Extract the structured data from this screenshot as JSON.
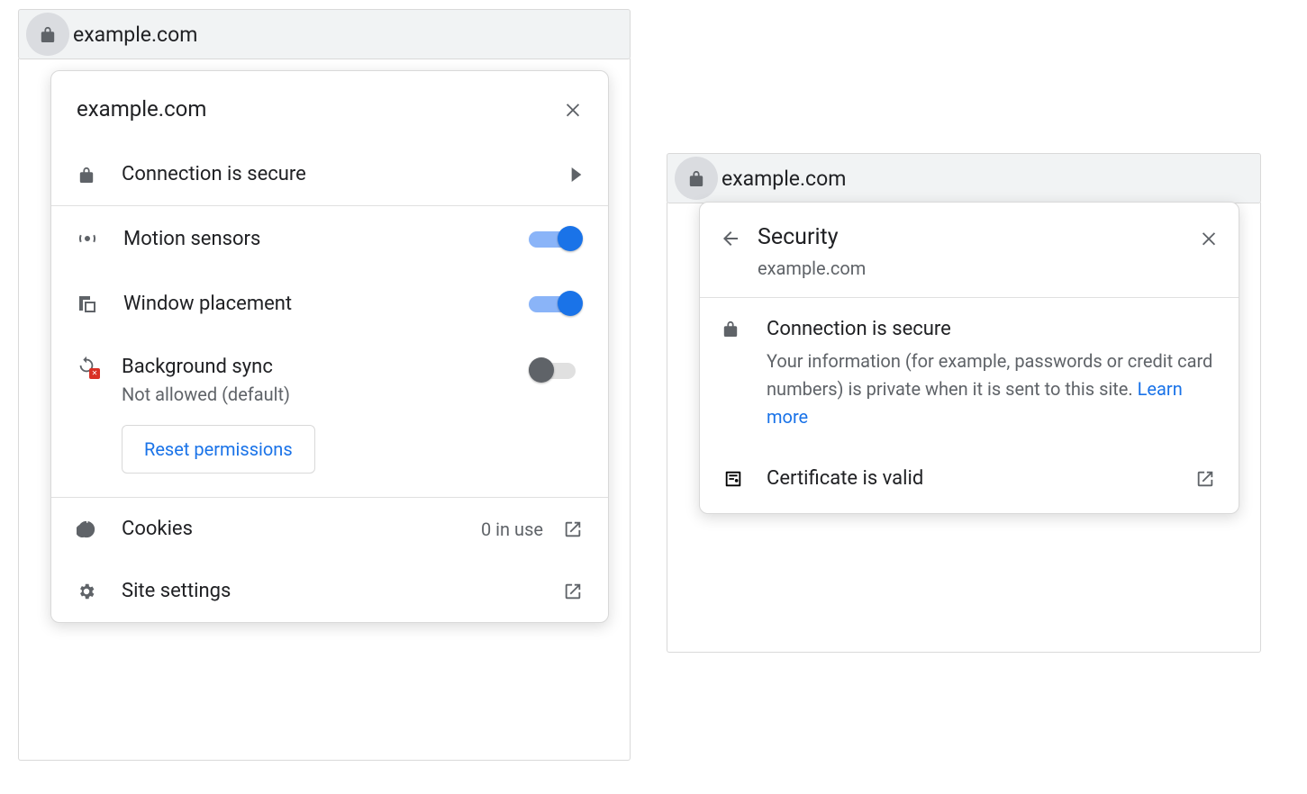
{
  "left": {
    "address": "example.com",
    "popup_title": "example.com",
    "connection_label": "Connection is secure",
    "permissions": [
      {
        "key": "motion",
        "label": "Motion sensors",
        "state": "on"
      },
      {
        "key": "window",
        "label": "Window placement",
        "state": "on"
      },
      {
        "key": "bgsync",
        "label": "Background sync",
        "state": "off",
        "sub": "Not allowed (default)"
      }
    ],
    "reset_label": "Reset permissions",
    "cookies_label": "Cookies",
    "cookies_count": "0 in use",
    "site_settings_label": "Site settings"
  },
  "right": {
    "address": "example.com",
    "panel_title": "Security",
    "panel_sub": "example.com",
    "conn_heading": "Connection is secure",
    "conn_desc": "Your information (for example, passwords or credit card numbers) is private when it is sent to this site. ",
    "learn_more": "Learn more",
    "cert_label": "Certificate is valid"
  }
}
